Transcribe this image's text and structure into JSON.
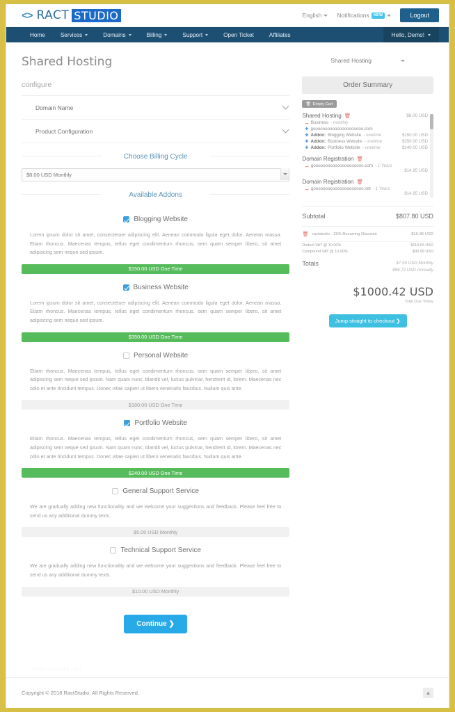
{
  "header": {
    "logo_glyph": "<>",
    "logo_ract": "RACT",
    "logo_studio": "STUDIO",
    "language": "English",
    "notifications": "Notifications",
    "notifications_badge": "NEW",
    "logout": "Logout"
  },
  "nav": {
    "items": [
      {
        "label": "Home",
        "caret": false
      },
      {
        "label": "Services",
        "caret": true
      },
      {
        "label": "Domains",
        "caret": true
      },
      {
        "label": "Billing",
        "caret": true
      },
      {
        "label": "Support",
        "caret": true
      },
      {
        "label": "Open Ticket",
        "caret": false
      },
      {
        "label": "Affiliates",
        "caret": false
      }
    ],
    "account": "Hello, Demo!"
  },
  "main": {
    "page_title": "Shared Hosting",
    "configure_label": "configure",
    "accordions": [
      {
        "label": "Domain Name"
      },
      {
        "label": "Product Configuration"
      }
    ],
    "billing_cycle_heading": "Choose Billing Cycle",
    "billing_cycle_value": "$8.00 USD Monthly",
    "available_addons_heading": "Available Addons",
    "addons": [
      {
        "name": "Blogging Website",
        "checked": true,
        "description": "Lorem ipsum dolor sit amet, consectetuer adipiscing elit. Aenean commodo ligula eget dolor. Aenean massa. Etiam rhoncus. Maecenas tempus, tellus eget condimentum rhoncus, sem quam semper libero, sit amet adipiscing sem neque sed ipsum.",
        "price": "$150.00 USD One Time"
      },
      {
        "name": "Business Website",
        "checked": true,
        "description": "Lorem ipsum dolor sit amet, consectetuer adipiscing elit. Aenean commodo ligula eget dolor. Aenean massa. Etiam rhoncus. Maecenas tempus, tellus eget condimentum rhoncus, sem quam semper libero, sit amet adipiscing sem neque sed ipsum.",
        "price": "$350.00 USD One Time"
      },
      {
        "name": "Personal Website",
        "checked": false,
        "description": "Etiam rhoncus. Maecenas tempus, tellus eget condimentum rhoncus, sem quam semper libero, sit amet adipiscing sem neque sed ipsum. Nam quam nunc, blandit vel, luctus pulvinar, hendrerit id, lorem. Maecenas nec odio et ante tincidunt tempus. Donec vitae sapien ut libero venenatis faucibus. Nullam quis ante.",
        "price": "$180.00 USD One Time"
      },
      {
        "name": "Portfolio Website",
        "checked": true,
        "description": "Etiam rhoncus. Maecenas tempus, tellus eget condimentum rhoncus, sem quam semper libero, sit amet adipiscing sem neque sed ipsum. Nam quam nunc, blandit vel, luctus pulvinar, hendrerit id, lorem. Maecenas nec odio et ante tincidunt tempus. Donec vitae sapien ut libero venenatis faucibus. Nullam quis ante.",
        "price": "$240.00 USD One Time"
      },
      {
        "name": "General Support Service",
        "checked": false,
        "description": "We are gradually adding new functionality and we welcome your suggestions and feedback. Please feel free to send us any additional dummy texts.",
        "price": "$5.00 USD Monthly"
      },
      {
        "name": "Technical Support Service",
        "checked": false,
        "description": "We are gradually adding new functionality and we welcome your suggestions and feedback. Please feel free to send us any additional dummy texts.",
        "price": "$10.00 USD Monthly"
      }
    ],
    "continue_label": "Continue"
  },
  "sidebar": {
    "category_selector": "Shared Hosting",
    "order_summary_title": "Order Summary",
    "empty_cart_label": "Empty Cart",
    "cart_items": [
      {
        "title": "Shared Hosting",
        "price": "$8.00 USD",
        "lines": [
          {
            "marker": "dash",
            "label": "Business",
            "meta": "- monthly",
            "amount": ""
          },
          {
            "marker": "plus",
            "label": "gooooooooooooooooooooo.com",
            "meta": "",
            "amount": ""
          },
          {
            "marker": "plus",
            "label": "Addon:",
            "bold_label": "Addon:",
            "name": "Blogging Website",
            "meta": "- onetime",
            "amount": "$150.00 USD"
          },
          {
            "marker": "plus",
            "label": "Addon:",
            "bold_label": "Addon:",
            "name": "Business Website",
            "meta": "- onetime",
            "amount": "$350.00 USD"
          },
          {
            "marker": "plus",
            "label": "Addon:",
            "bold_label": "Addon:",
            "name": "Portfolio Website",
            "meta": "- onetime",
            "amount": "$240.00 USD"
          }
        ]
      },
      {
        "title": "Domain Registration",
        "price": "",
        "lines": [
          {
            "marker": "dash",
            "label": "gooooooooooooooooooooo.com",
            "meta": "- 1 Years",
            "amount": ""
          }
        ],
        "sub_amount": "$14.95 USD"
      },
      {
        "title": "Domain Registration",
        "price": "",
        "lines": [
          {
            "marker": "dash",
            "label": "gooooooooooooooooooooo.net",
            "meta": "- 1 Years",
            "amount": ""
          }
        ],
        "sub_amount": "$14.95 USD"
      }
    ],
    "subtotal_label": "Subtotal",
    "subtotal_value": "$807.80 USD",
    "discount_label": "ractstudio - 25% Recurring Discount",
    "discount_value": "-$16.96 USD",
    "vat_rows": [
      {
        "label": "Deduct VAT @ 10.00%",
        "value": "$110.63 USD"
      },
      {
        "label": "Compound VAT @ 10.00%",
        "value": "$90.99 USD"
      }
    ],
    "totals_label": "Totals",
    "totals_monthly": "$7.59 USD Monthly",
    "totals_annually": "$56.72 USD Annually",
    "grand_total": "$1000.42 USD",
    "grand_total_caption": "Total Due Today",
    "checkout_label": "Jump straight to checkout"
  },
  "footer": {
    "watermark": "www.ractstudio.com",
    "copyright": "Copyright © 2018 RactStudio, All Rights Reserved.",
    "to_top_icon": "back-to-top"
  }
}
